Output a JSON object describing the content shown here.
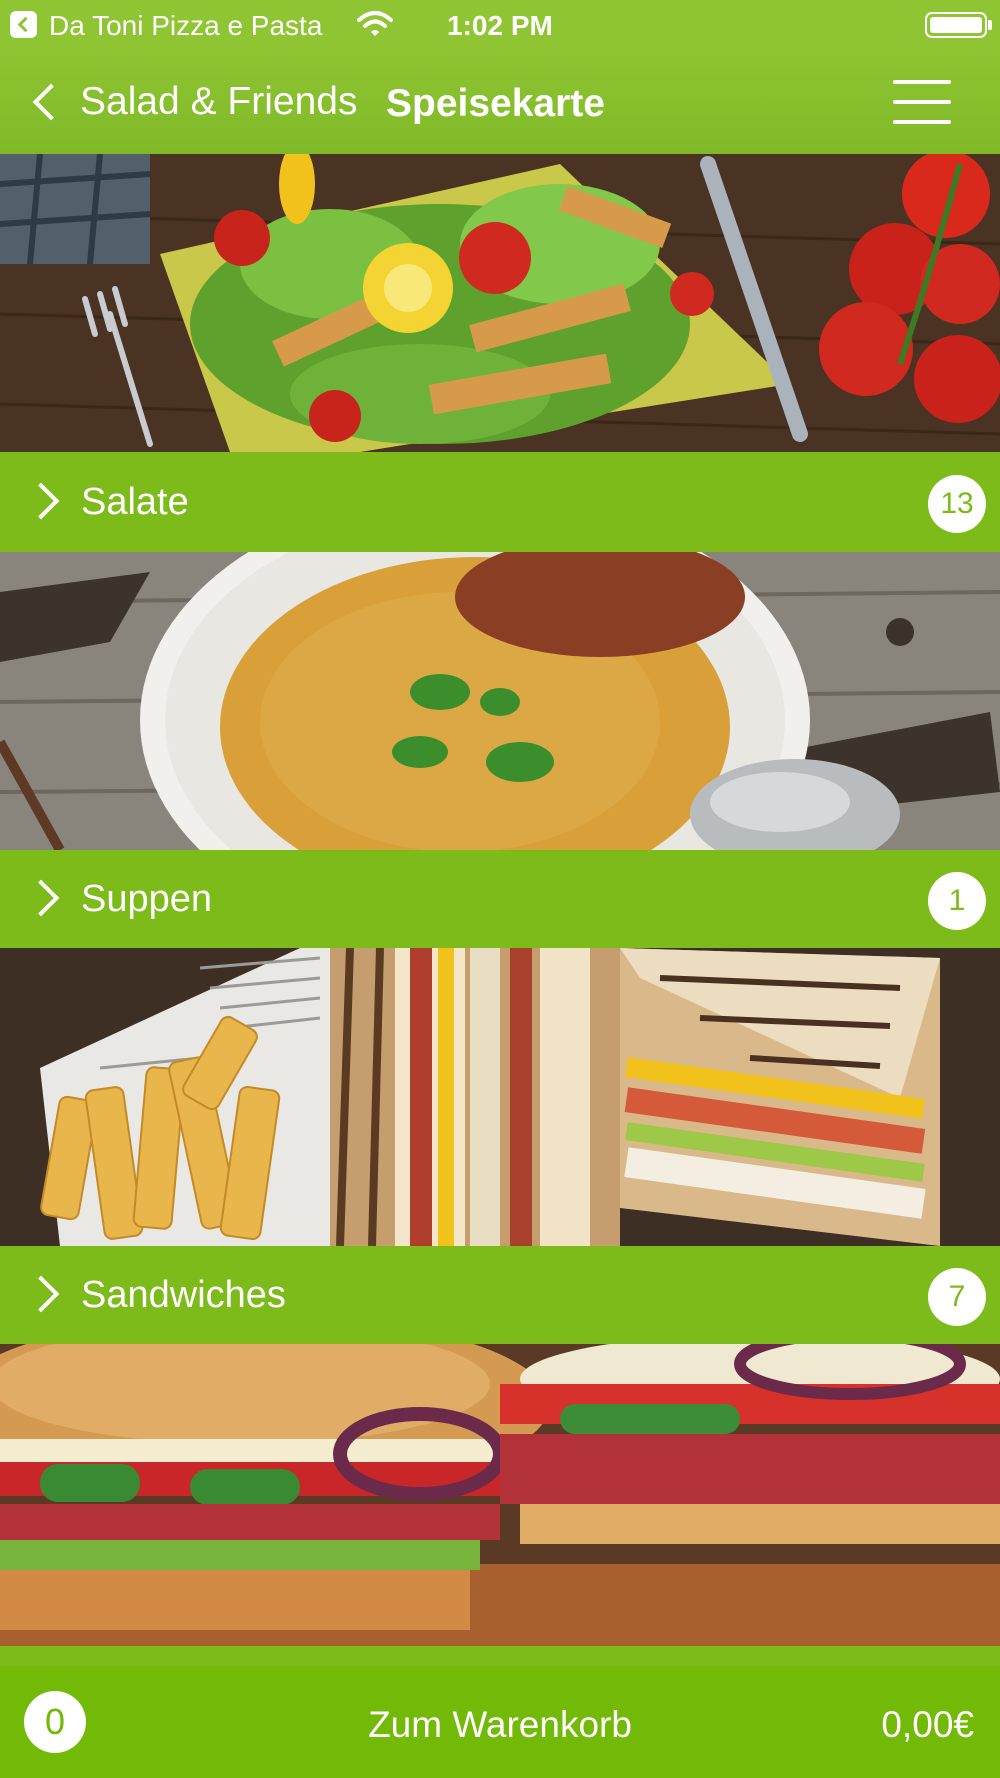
{
  "status_bar": {
    "app_name": "Da Toni Pizza e Pasta",
    "time": "1:02 PM"
  },
  "nav": {
    "back_label": "Salad & Friends",
    "title": "Speisekarte"
  },
  "categories": [
    {
      "label": "Salate",
      "count": "13"
    },
    {
      "label": "Suppen",
      "count": "1"
    },
    {
      "label": "Sandwiches",
      "count": "7"
    }
  ],
  "cart": {
    "count": "0",
    "label": "Zum Warenkorb",
    "total": "0,00€"
  },
  "icons": [
    "back-to-app-icon",
    "wifi-icon",
    "battery-icon",
    "chevron-left-icon",
    "hamburger-menu-icon",
    "chevron-right-icon"
  ],
  "colors": {
    "brand_green": "#7cbb1a",
    "status_green": "#8fc432",
    "cart_green": "#73b908"
  }
}
